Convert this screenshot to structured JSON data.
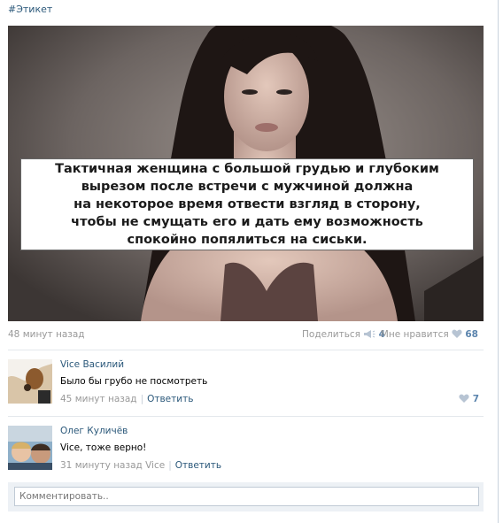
{
  "post": {
    "hashtag": "#Этикет",
    "caption": "Тактичная женщина с большой грудью и глубоким\nвырезом после встречи с мужчиной должна\nна некоторое время отвести взгляд в сторону,\nчтобы не смущать его и дать ему возможность\nспокойно попялиться на сиськи.",
    "time": "48 минут назад",
    "share_label": "Поделиться",
    "share_count": "4",
    "like_label": "Мне нравится",
    "like_count": "68"
  },
  "comments": [
    {
      "author": "Vice Василий",
      "text": "Было бы грубо не посмотреть",
      "time": "45 минут назад",
      "reply_label": "Ответить",
      "likes": "7"
    },
    {
      "author": "Олег Куличёв",
      "text": "Vice, тоже верно!",
      "time": "31 минуту назад Vice",
      "reply_label": "Ответить"
    }
  ],
  "compose": {
    "placeholder": "Комментировать.."
  },
  "colors": {
    "link": "#2b587a",
    "accent": "#5b84ad",
    "muted": "#999999",
    "compose_bg": "#edf1f5"
  },
  "icons": {
    "share": "megaphone-icon",
    "like": "heart-icon"
  }
}
